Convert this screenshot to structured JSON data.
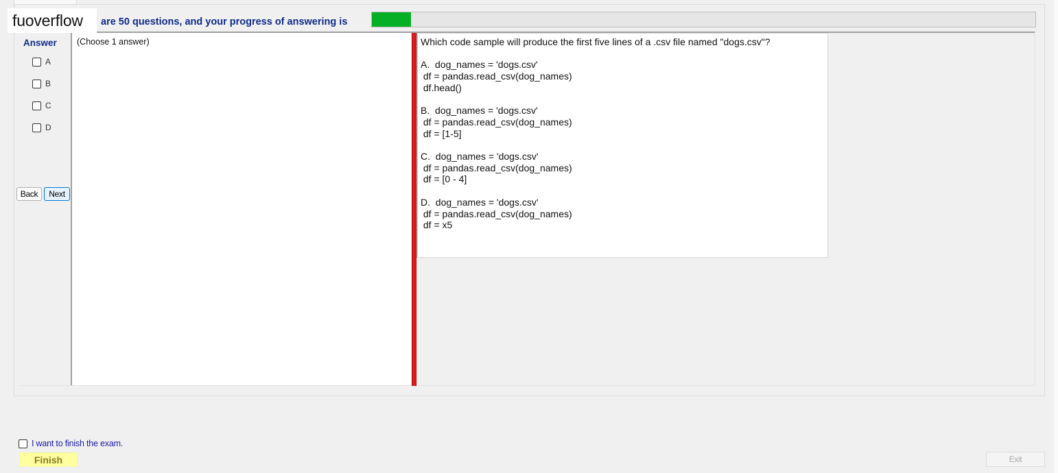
{
  "watermark": "fuoverflow",
  "progress": {
    "label": "are 50 questions, and your progress of answering is",
    "fraction": 0.059
  },
  "answer": {
    "title": "Answer",
    "options": [
      "A",
      "B",
      "C",
      "D"
    ]
  },
  "nav": {
    "back_label": "Back",
    "next_label": "Next"
  },
  "choose_label": "(Choose 1 answer)",
  "question": {
    "text": "Which code sample will produce the first five lines of a .csv file named \"dogs.csv\"?\n\nA.  dog_names = 'dogs.csv'\n df = pandas.read_csv(dog_names)\n df.head()\n\nB.  dog_names = 'dogs.csv'\n df = pandas.read_csv(dog_names)\n df = [1-5]\n\nC.  dog_names = 'dogs.csv'\n df = pandas.read_csv(dog_names)\n df = [0 - 4]\n\nD.  dog_names = 'dogs.csv'\n df = pandas.read_csv(dog_names)\n df = x5"
  },
  "footer": {
    "finish_check_label": "I want to finish the exam.",
    "finish_label": "Finish",
    "exit_label": "Exit"
  },
  "colors": {
    "accent_text": "#0f2a8a",
    "progress_fill": "#06b025",
    "splitter": "#e31b1b",
    "finish_bg": "#ffffa0"
  }
}
